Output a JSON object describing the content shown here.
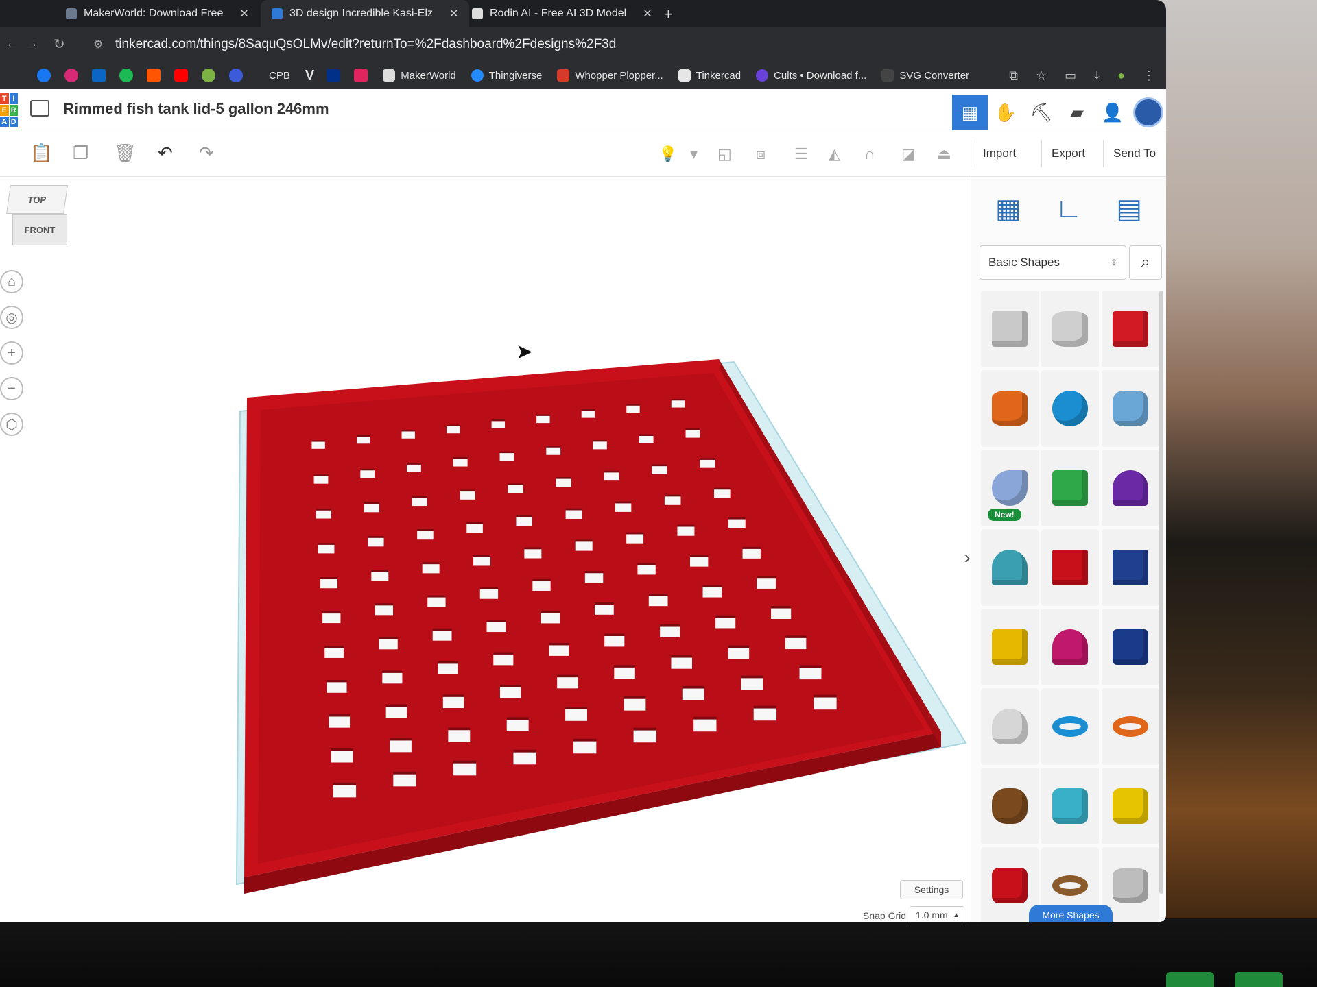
{
  "browser": {
    "tabs": [
      {
        "label": "MakerWorld: Download Free"
      },
      {
        "label": "3D design Incredible Kasi-Elz"
      },
      {
        "label": "Rodin AI - Free AI 3D Model"
      }
    ],
    "url": "tinkercad.com/things/8SaquQsOLMv/edit?returnTo=%2Fdashboard%2Fdesigns%2F3d",
    "bookmarks": [
      {
        "label": "CPB"
      },
      {
        "label": "MakerWorld"
      },
      {
        "label": "Thingiverse"
      },
      {
        "label": "Whopper Plopper..."
      },
      {
        "label": "Tinkercad"
      },
      {
        "label": "Cults • Download f..."
      },
      {
        "label": "SVG Converter"
      }
    ]
  },
  "app": {
    "logo_letters": [
      "T",
      "I",
      "N",
      "K",
      "E",
      "R",
      "C",
      "A",
      "D"
    ],
    "title": "Rimmed fish tank lid-5 gallon 246mm",
    "toolbar": {
      "import_label": "Import",
      "export_label": "Export",
      "send_to_label": "Send To"
    },
    "viewcube": {
      "top": "TOP",
      "front": "FRONT"
    },
    "workplane": {
      "settings_label": "Settings",
      "snap_grid_label": "Snap Grid",
      "snap_grid_value": "1.0 mm"
    },
    "panel": {
      "category": "Basic Shapes",
      "new_badge": "New!",
      "more_shapes_label": "More Shapes",
      "shapes": [
        {
          "icon": "box-striped-icon"
        },
        {
          "icon": "cylinder-striped-icon"
        },
        {
          "icon": "box-icon"
        },
        {
          "icon": "cylinder-icon"
        },
        {
          "icon": "sphere-icon"
        },
        {
          "icon": "scribble-icon"
        },
        {
          "icon": "shape-generator-icon"
        },
        {
          "icon": "roof-icon"
        },
        {
          "icon": "cone-icon"
        },
        {
          "icon": "round-roof-icon"
        },
        {
          "icon": "text-icon"
        },
        {
          "icon": "wedge-icon"
        },
        {
          "icon": "pyramid-icon"
        },
        {
          "icon": "half-sphere-icon"
        },
        {
          "icon": "polygon-icon"
        },
        {
          "icon": "paraboloid-icon"
        },
        {
          "icon": "torus-icon"
        },
        {
          "icon": "tube-icon"
        },
        {
          "icon": "heart-icon"
        },
        {
          "icon": "star-icon"
        },
        {
          "icon": "star-yellow-icon"
        },
        {
          "icon": "icosahedron-icon"
        },
        {
          "icon": "ring-icon"
        },
        {
          "icon": "cylinder-gray-icon"
        }
      ]
    }
  },
  "colors": {
    "model_red": "#c8101a",
    "accent_blue": "#2e7ad6",
    "new_green": "#1a8f3a"
  }
}
